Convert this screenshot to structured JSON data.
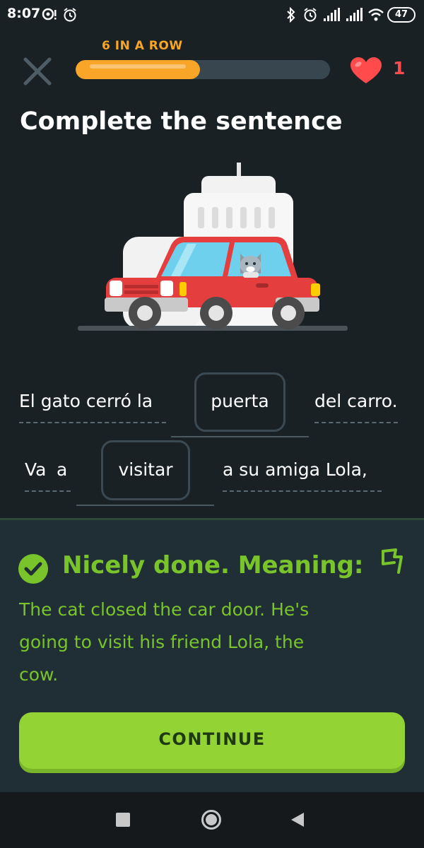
{
  "status_bar": {
    "time": "8:07",
    "battery": "47",
    "icons": [
      "chat-bubble-icon",
      "alarm-icon",
      "bluetooth-icon",
      "alarm-icon",
      "signal-icon",
      "signal-icon",
      "wifi-icon",
      "battery-icon"
    ]
  },
  "header": {
    "streak_label": "6 IN A ROW",
    "progress_fraction": 0.49,
    "hearts": "1",
    "icons": {
      "close": "close-icon",
      "heart": "heart-icon"
    }
  },
  "main": {
    "title": "Complete the sentence",
    "illustration": "cat-driving-car-illustration",
    "line1": {
      "before": "El gato cerró la",
      "answer": "puerta",
      "after": "del carro."
    },
    "line2": {
      "before_1": "Va",
      "before_2": "a",
      "answer": "visitar",
      "after": "a  su amiga Lola,"
    }
  },
  "feedback": {
    "title": "Nicely done. Meaning:",
    "text": "The cat closed the car door. He's going to visit his friend Lola, the cow.",
    "continue_label": "CONTINUE",
    "icons": {
      "check": "check-circle-icon",
      "report": "flag-icon"
    }
  },
  "colors": {
    "background": "#1a2125",
    "accent_orange": "#f8a528",
    "heart_red": "#ff4b4b",
    "success_green": "#79c42b",
    "button_green": "#93d333",
    "panel": "#202f36"
  },
  "nav_bar": {
    "icons": [
      "recents-square-icon",
      "home-circle-icon",
      "back-triangle-icon"
    ]
  }
}
